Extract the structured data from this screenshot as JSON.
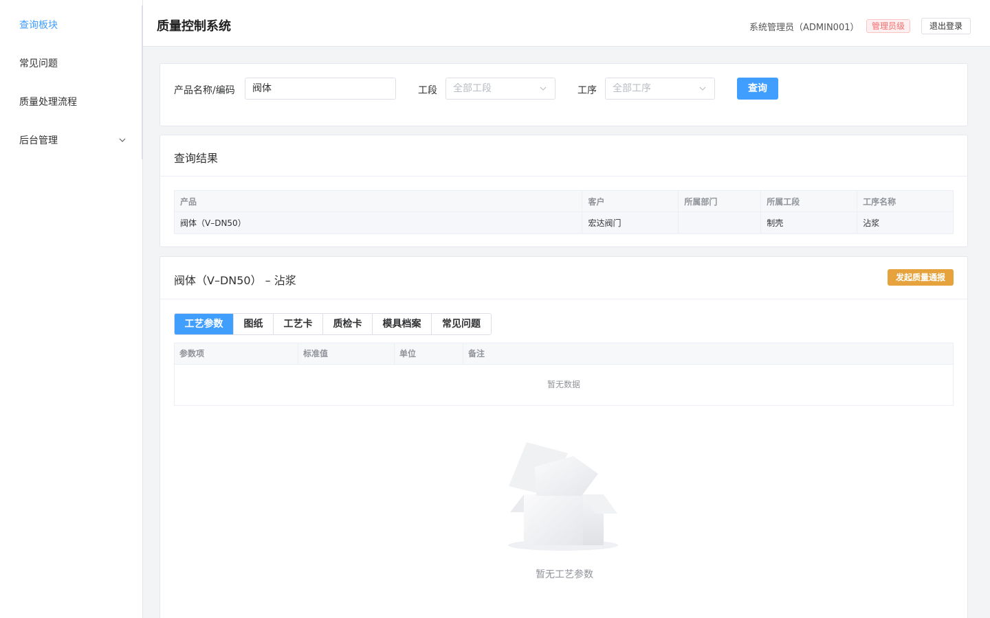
{
  "sidebar": {
    "items": [
      {
        "label": "查询板块",
        "active": true
      },
      {
        "label": "常见问题",
        "active": false
      },
      {
        "label": "质量处理流程",
        "active": false
      },
      {
        "label": "后台管理",
        "active": false,
        "expandable": true
      }
    ]
  },
  "header": {
    "title": "质量控制系统",
    "user": "系统管理员（ADMIN001）",
    "role_badge": "管理员级",
    "logout_label": "退出登录"
  },
  "query": {
    "product_label": "产品名称/编码",
    "product_value": "阀体",
    "section_label": "工段",
    "section_value": "全部工段",
    "process_label": "工序",
    "process_value": "全部工序",
    "button_label": "查询"
  },
  "results": {
    "title": "查询结果",
    "columns": [
      "产品",
      "客户",
      "所属部门",
      "所属工段",
      "工序名称"
    ],
    "rows": [
      [
        "阀体（V–DN50）",
        "宏达阀门",
        "",
        "制壳",
        "沾浆"
      ]
    ]
  },
  "detail": {
    "title": "阀体（V–DN50） – 沾浆",
    "notify_button": "发起质量通报",
    "tabs": [
      {
        "label": "工艺参数",
        "active": true
      },
      {
        "label": "图纸",
        "active": false
      },
      {
        "label": "工艺卡",
        "active": false
      },
      {
        "label": "质检卡",
        "active": false
      },
      {
        "label": "模具档案",
        "active": false
      },
      {
        "label": "常见问题",
        "active": false
      }
    ],
    "param_columns": [
      "参数项",
      "标准值",
      "单位",
      "备注"
    ],
    "table_empty": "暂无数据",
    "empty_text": "暂无工艺参数"
  },
  "colors": {
    "primary": "#409eff",
    "warning": "#e6a23c",
    "danger": "#f56c6c"
  }
}
